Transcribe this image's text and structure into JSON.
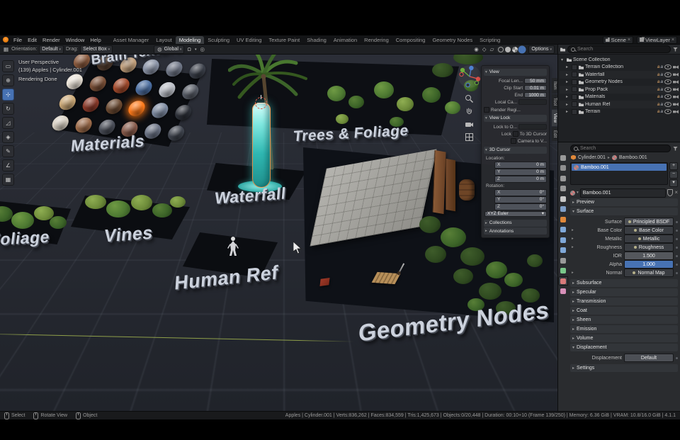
{
  "topbar": {
    "menus": [
      "File",
      "Edit",
      "Render",
      "Window",
      "Help"
    ],
    "workspaces": [
      "Asset Manager",
      "Layout",
      "Modeling",
      "Sculpting",
      "UV Editing",
      "Texture Paint",
      "Shading",
      "Animation",
      "Rendering",
      "Compositing",
      "Geometry Nodes",
      "Scripting"
    ],
    "active_workspace": "Modeling",
    "scene": {
      "label": "Scene"
    },
    "view_layer": {
      "label": "ViewLayer"
    }
  },
  "tool_header": {
    "orientation_label": "Orientation:",
    "orientation_value": "Default",
    "drag_label": "Drag:",
    "drag_value": "Select Box",
    "transform_orientation": "Global",
    "options_label": "Options"
  },
  "toolbar": {
    "tools": [
      "select-box",
      "cursor",
      "move",
      "rotate",
      "scale",
      "transform",
      "annotate",
      "measure",
      "add-cube"
    ],
    "active_tool": "move"
  },
  "viewport": {
    "overlay_info": [
      "User Perspective",
      "(139) Apples | Cylinder.001",
      "Rendering Done"
    ],
    "scene_labels": [
      {
        "id": "brain-texture",
        "text": "Brain Texture"
      },
      {
        "id": "materials",
        "text": "Materials"
      },
      {
        "id": "trees-foliage",
        "text": "Trees & Foliage"
      },
      {
        "id": "waterfall",
        "text": "Waterfall"
      },
      {
        "id": "vines",
        "text": "Vines"
      },
      {
        "id": "foliage",
        "text": "Foliage"
      },
      {
        "id": "human-ref",
        "text": "Human Ref"
      },
      {
        "id": "geometry-nodes",
        "text": "Geometry Nodes"
      }
    ],
    "material_sphere_colors": [
      "#8a5a3e",
      "#5c4434",
      "#c2a07c",
      "#8a93a6",
      "#6e7585",
      "#3a3f49",
      "#e9e2d7",
      "#7c5138",
      "#a34a2c",
      "#4a6da0",
      "#b9bdc5",
      "#575c66",
      "#caa877",
      "#8b3a2a",
      "#6b4a32",
      "#ff7b1c",
      "#7d8aa0",
      "#2e323a",
      "#d8d0c3",
      "#9c6b4a",
      "#4a4e58",
      "#875a4a",
      "#6a7284",
      "#3f444e"
    ],
    "glow_index": 15
  },
  "n_panel": {
    "tabs": [
      "Item",
      "Tool",
      "View",
      "Edit"
    ],
    "active_tab": "View",
    "view_section": {
      "title": "View",
      "rows": [
        {
          "label": "Focal Len...",
          "value": "50 mm"
        },
        {
          "label": "Clip Start",
          "value": "0.01 m"
        },
        {
          "label": "End",
          "value": "1000 m"
        },
        {
          "label": "Local Ca...",
          "value": ""
        }
      ],
      "render_region": "Render Regi..."
    },
    "view_lock_section": {
      "title": "View Lock",
      "lock_to_label": "Lock to O...",
      "lock_label": "Lock",
      "to_3d_cursor": "To 3D Cursor",
      "camera_to_view": "Camera to V..."
    },
    "cursor_section": {
      "title": "3D Cursor",
      "location_label": "Location:",
      "rotation_label": "Rotation:",
      "location": [
        {
          "axis": "X",
          "value": "0 m"
        },
        {
          "axis": "Y",
          "value": "0 m"
        },
        {
          "axis": "Z",
          "value": "0 m"
        }
      ],
      "rotation": [
        {
          "axis": "X",
          "value": "0°"
        },
        {
          "axis": "Y",
          "value": "0°"
        },
        {
          "axis": "Z",
          "value": "0°"
        }
      ],
      "rotation_mode": "XYZ Euler"
    },
    "collapsed_sections": [
      "Collections",
      "Annotations"
    ]
  },
  "outliner": {
    "search_placeholder": "Search",
    "root": "Scene Collection",
    "collections": [
      "Terrain Collection",
      "Waterfall",
      "Geometry Nodes",
      "Prop Pack",
      "Materials",
      "Human Ref",
      "Terrain"
    ]
  },
  "properties": {
    "search_placeholder": "Search",
    "tabs": [
      "tool",
      "render",
      "output",
      "view-layer",
      "scene",
      "world",
      "object",
      "modifiers",
      "particles",
      "physics",
      "constraints",
      "object-data",
      "material",
      "texture"
    ],
    "active_tab": "material",
    "breadcrumb": {
      "object": "Cylinder.001",
      "material": "Bamboo.001"
    },
    "slot_name": "Bamboo.001",
    "material_name": "Bamboo.001",
    "preview_section": "Preview",
    "surface_section": {
      "title": "Surface",
      "rows": [
        {
          "label": "Surface",
          "value": "Principled BSDF",
          "type": "menu"
        },
        {
          "label": "Base Color",
          "value": "Base Color",
          "type": "link"
        },
        {
          "label": "Metallic",
          "value": "Metallic",
          "type": "link"
        },
        {
          "label": "Roughness",
          "value": "Roughness",
          "type": "link"
        },
        {
          "label": "IOR",
          "value": "1.500",
          "type": "number"
        },
        {
          "label": "Alpha",
          "value": "1.000",
          "type": "slider"
        },
        {
          "label": "Normal",
          "value": "Normal Map",
          "type": "link"
        }
      ]
    },
    "collapsed_sections": [
      "Subsurface",
      "Specular",
      "Transmission",
      "Coat",
      "Sheen",
      "Emission",
      "Volume"
    ],
    "displacement_section": {
      "title": "Displacement",
      "label": "Displacement",
      "value": "Default"
    },
    "settings_section": "Settings"
  },
  "status_bar": {
    "left_items": [
      "Select",
      "Rotate View",
      "Object"
    ],
    "stats": "Apples | Cylinder.001 | Verts:836,262 | Faces:834,559 | Tris:1,425,673 | Objects:0/20,448 | Duration: 00:10+10 (Frame 139/250) | Memory: 6.36 GiB | VRAM: 10.8/16.0 GiB | 4.1.1"
  },
  "colors": {
    "accent_blue": "#4772b3",
    "selection_orange": "#e87d0d",
    "waterfall_cyan": "#35c8c2",
    "axis_x": "#e5534b",
    "axis_y": "#6fae3c",
    "axis_z": "#4e80d0"
  }
}
